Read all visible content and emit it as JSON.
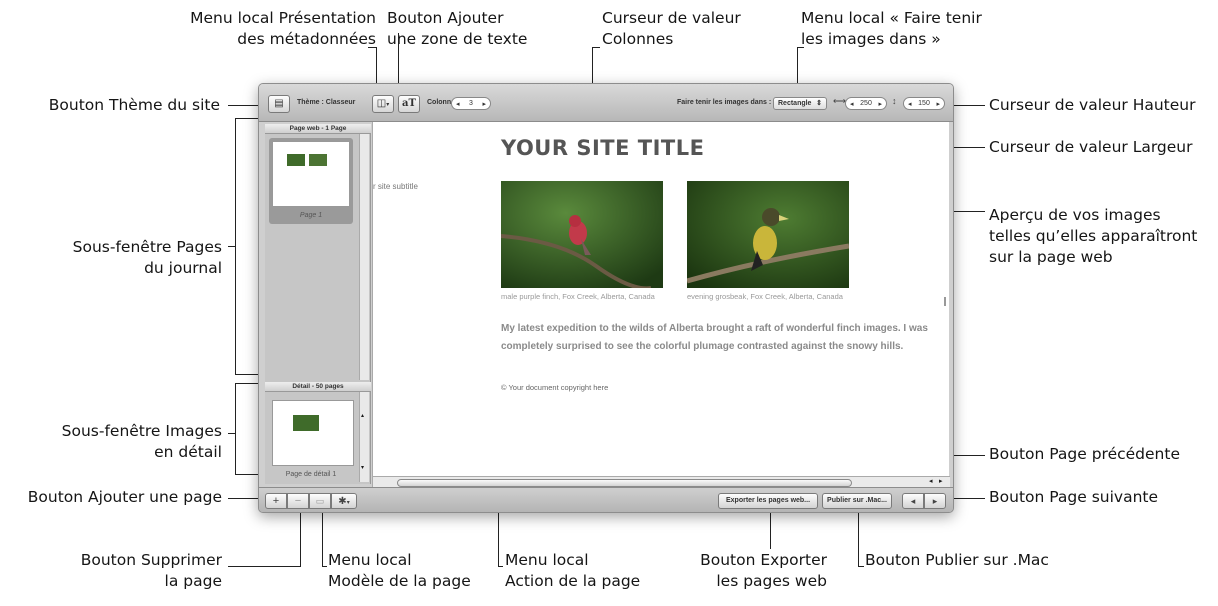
{
  "callouts": {
    "presentation_menu": [
      "Menu local Présentation",
      "des métadonnées"
    ],
    "add_text_button": [
      "Bouton Ajouter",
      "une zone de texte"
    ],
    "columns_slider": [
      "Curseur de valeur",
      "Colonnes"
    ],
    "fit_images_menu": [
      "Menu local « Faire tenir",
      "les images dans »"
    ],
    "theme_button": "Bouton Thème du site",
    "height_slider": "Curseur de valeur Hauteur",
    "width_slider": "Curseur de valeur Largeur",
    "journal_pages_pane": [
      "Sous-fenêtre Pages",
      "du journal"
    ],
    "preview": [
      "Aperçu de vos images",
      "telles qu’elles apparaîtront",
      "sur la page web"
    ],
    "detail_images_pane": [
      "Sous-fenêtre Images",
      "en détail"
    ],
    "previous_page_button": "Bouton Page précédente",
    "add_page_button": "Bouton Ajouter une page",
    "next_page_button": "Bouton Page suivante",
    "delete_page_button": [
      "Bouton Supprimer",
      "la page"
    ],
    "page_template_menu": [
      "Menu local",
      "Modèle de la page"
    ],
    "page_action_menu": [
      "Menu local",
      "Action de la page"
    ],
    "export_button": [
      "Bouton Exporter",
      "les pages web"
    ],
    "publish_button": "Bouton Publier sur .Mac"
  },
  "toolbar": {
    "theme_label": "Thème : Classeur",
    "columns_label": "Colonnes :",
    "columns_value": "3",
    "fit_label": "Faire tenir les images dans :",
    "fit_value": "Rectangle",
    "width_value": "250",
    "height_value": "150"
  },
  "sidebar": {
    "pages_header": "Page web - 1 Page",
    "page_thumb_label": "Page 1",
    "detail_header": "Détail - 50 pages",
    "detail_thumb_label": "Page de détail 1"
  },
  "content": {
    "site_title": "YOUR SITE TITLE",
    "site_subtitle": "r site subtitle",
    "photos": [
      {
        "caption": "male purple finch, Fox Creek, Alberta, Canada",
        "bird_color": "#c23a4a"
      },
      {
        "caption": "evening grosbeak, Fox Creek, Alberta, Canada",
        "bird_color": "#c9b63a"
      }
    ],
    "body_text": "My latest expedition to the wilds of Alberta brought a raft of wonderful finch images. I was completely surprised to see the colorful plumage contrasted against the snowy hills.",
    "copyright": "© Your document copyright here"
  },
  "bottombar": {
    "add_label": "+",
    "delete_label": "−",
    "export_label": "Exporter les pages web...",
    "publish_label": "Publier sur .Mac..."
  }
}
